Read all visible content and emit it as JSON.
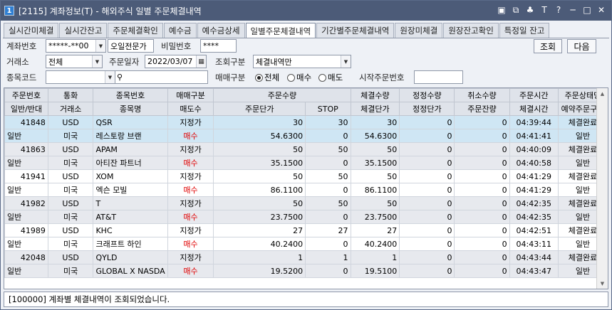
{
  "window": {
    "badge": "1",
    "title": "[2115] 계좌정보(T) - 해외주식 일별 주문체결내역",
    "icons": [
      "doc-icon",
      "restore-icon",
      "pin-icon",
      "font-icon",
      "help-icon",
      "minimize-icon",
      "maximize-icon",
      "close-icon"
    ],
    "icon_glyphs": [
      "▣",
      "⧉",
      "♣",
      "T",
      "?",
      "─",
      "□",
      "✕"
    ]
  },
  "tabs": [
    {
      "label": "실시간미체결",
      "active": false
    },
    {
      "label": "실시간잔고",
      "active": false
    },
    {
      "label": "주문체결확인",
      "active": false
    },
    {
      "label": "예수금",
      "active": false
    },
    {
      "label": "예수금상세",
      "active": false
    },
    {
      "label": "일별주문체결내역",
      "active": true
    },
    {
      "label": "기간별주문체결내역",
      "active": false
    },
    {
      "label": "원장미체결",
      "active": false
    },
    {
      "label": "원장잔고확인",
      "active": false
    },
    {
      "label": "특정일 잔고",
      "active": false
    }
  ],
  "form": {
    "account_label": "계좌번호",
    "account_value": "*****-**00",
    "account_name": "오일전문가",
    "password_label": "비밀번호",
    "password_value": "****",
    "exchange_label": "거래소",
    "exchange_value": "전체",
    "order_date_label": "주문일자",
    "order_date_value": "2022/03/07",
    "query_type_label": "조회구분",
    "query_type_value": "체결내역만",
    "symbol_label": "종목코드",
    "symbol_value": "",
    "side_label": "매매구분",
    "side_options": [
      "전체",
      "매수",
      "매도"
    ],
    "side_selected": "전체",
    "start_order_label": "시작주문번호",
    "start_order_value": "",
    "query_button": "조회",
    "next_button": "다음"
  },
  "grid": {
    "header_row1": [
      "주문번호",
      "통화",
      "종목번호",
      "매매구분",
      "주문수량",
      "",
      "체결수량",
      "정정수량",
      "취소수량",
      "주문시간",
      "주문상태명"
    ],
    "header_row2": [
      "일반/반대",
      "거래소",
      "종목명",
      "매도수",
      "주문단가",
      "STOP",
      "체결단가",
      "정정단가",
      "주문잔량",
      "체결시간",
      "예약주문구분"
    ],
    "orders": [
      {
        "order_no": "41848",
        "currency": "USD",
        "symbol": "QSR",
        "order_type": "지정가",
        "order_qty": "30",
        "stop_qty": "30",
        "filled_qty": "30",
        "modify_qty": "0",
        "cancel_qty": "0",
        "order_time": "04:39:44",
        "status": "체결완료",
        "general": "일반",
        "exchange": "미국",
        "name": "레스토랑 브랜",
        "side": "매수",
        "order_price": "54.6300",
        "stop": "0",
        "filled_price": "54.6300",
        "modify_price": "0",
        "remaining": "0",
        "filled_time": "04:41:41",
        "reserve": "일반",
        "selected": true
      },
      {
        "order_no": "41863",
        "currency": "USD",
        "symbol": "APAM",
        "order_type": "지정가",
        "order_qty": "50",
        "stop_qty": "50",
        "filled_qty": "50",
        "modify_qty": "0",
        "cancel_qty": "0",
        "order_time": "04:40:09",
        "status": "체결완료",
        "general": "일반",
        "exchange": "미국",
        "name": "아티잔 파트너",
        "side": "매수",
        "order_price": "35.1500",
        "stop": "0",
        "filled_price": "35.1500",
        "modify_price": "0",
        "remaining": "0",
        "filled_time": "04:40:58",
        "reserve": "일반",
        "selected": false
      },
      {
        "order_no": "41941",
        "currency": "USD",
        "symbol": "XOM",
        "order_type": "지정가",
        "order_qty": "50",
        "stop_qty": "50",
        "filled_qty": "50",
        "modify_qty": "0",
        "cancel_qty": "0",
        "order_time": "04:41:29",
        "status": "체결완료",
        "general": "일반",
        "exchange": "미국",
        "name": "엑슨 모빌",
        "side": "매수",
        "order_price": "86.1100",
        "stop": "0",
        "filled_price": "86.1100",
        "modify_price": "0",
        "remaining": "0",
        "filled_time": "04:41:29",
        "reserve": "일반",
        "selected": false
      },
      {
        "order_no": "41982",
        "currency": "USD",
        "symbol": "T",
        "order_type": "지정가",
        "order_qty": "50",
        "stop_qty": "50",
        "filled_qty": "50",
        "modify_qty": "0",
        "cancel_qty": "0",
        "order_time": "04:42:35",
        "status": "체결완료",
        "general": "일반",
        "exchange": "미국",
        "name": "AT&T",
        "side": "매수",
        "order_price": "23.7500",
        "stop": "0",
        "filled_price": "23.7500",
        "modify_price": "0",
        "remaining": "0",
        "filled_time": "04:42:35",
        "reserve": "일반",
        "selected": false
      },
      {
        "order_no": "41989",
        "currency": "USD",
        "symbol": "KHC",
        "order_type": "지정가",
        "order_qty": "27",
        "stop_qty": "27",
        "filled_qty": "27",
        "modify_qty": "0",
        "cancel_qty": "0",
        "order_time": "04:42:51",
        "status": "체결완료",
        "general": "일반",
        "exchange": "미국",
        "name": "크래프트 하인",
        "side": "매수",
        "order_price": "40.2400",
        "stop": "0",
        "filled_price": "40.2400",
        "modify_price": "0",
        "remaining": "0",
        "filled_time": "04:43:11",
        "reserve": "일반",
        "selected": false
      },
      {
        "order_no": "42048",
        "currency": "USD",
        "symbol": "QYLD",
        "order_type": "지정가",
        "order_qty": "1",
        "stop_qty": "1",
        "filled_qty": "1",
        "modify_qty": "0",
        "cancel_qty": "0",
        "order_time": "04:43:44",
        "status": "체결완료",
        "general": "일반",
        "exchange": "미국",
        "name": "GLOBAL X NASDA",
        "side": "매수",
        "order_price": "19.5200",
        "stop": "0",
        "filled_price": "19.5100",
        "modify_price": "0",
        "remaining": "0",
        "filled_time": "04:43:47",
        "reserve": "일반",
        "selected": false
      }
    ]
  },
  "status_bar": {
    "message": "[100000] 계좌별 체결내역이 조회되었습니다."
  },
  "colors": {
    "titlebar": "#4c5b78",
    "selected_row": "#cfe6f4",
    "alt_row": "#e7e9ee",
    "buy_text": "#e00000"
  }
}
